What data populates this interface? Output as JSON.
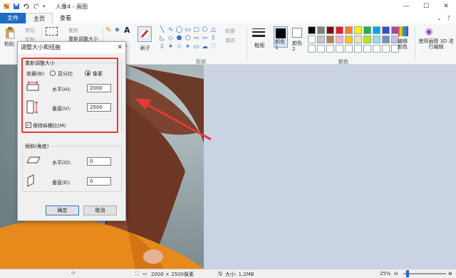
{
  "app": {
    "window_title": "人像4 - 画图",
    "window_buttons": [
      "—",
      "☐",
      "✕"
    ]
  },
  "tabs": {
    "file": "文件",
    "home": "主页",
    "view": "查看"
  },
  "ribbon": {
    "paste": "粘贴",
    "cut": "剪切",
    "copy": "复制",
    "crop": "裁剪",
    "resize": "重新调整大小",
    "rotate": "旋转",
    "brushes": "刷子",
    "outline": "轮廓",
    "fill": "填充",
    "shapes_group": "形状",
    "size": "粗细",
    "color1": "颜色 1",
    "color2": "颜色 2",
    "edit_colors": "编辑颜色",
    "paint3d": "使用画图 3D 进行编辑",
    "colors_group": "颜色",
    "palette": [
      "#000000",
      "#7f7f7f",
      "#880015",
      "#ed1c24",
      "#ff7f27",
      "#fff200",
      "#22b14c",
      "#00a2e8",
      "#3f48cc",
      "#a349a4",
      "#ffffff",
      "#c3c3c3",
      "#b97a57",
      "#ffaec9",
      "#ffc90e",
      "#efe4b0",
      "#b5e61d",
      "#99d9ea",
      "#7092be",
      "#c8bfe7",
      "#ffffff",
      "#ffffff",
      "#ffffff",
      "#ffffff",
      "#ffffff",
      "#ffffff",
      "#ffffff",
      "#ffffff",
      "#ffffff",
      "#ffffff"
    ]
  },
  "dialog": {
    "title": "调整大小和扭曲",
    "close": "✕",
    "resize_section": "重新调整大小",
    "by_label": "依据(B):",
    "percent_label": "百分比",
    "pixels_label": "像素",
    "horizontal_label": "水平(H):",
    "horizontal_value": "2000",
    "vertical_label": "垂直(V):",
    "vertical_value": "2500",
    "keep_ratio_label": "保持纵横比(M)",
    "skew_section": "倾斜(角度)",
    "skew_h_label": "水平(O):",
    "skew_h_value": "0",
    "skew_v_label": "垂直(E):",
    "skew_v_value": "0",
    "ok": "确定",
    "cancel": "取消"
  },
  "status": {
    "dimensions": "2000 × 2500像素",
    "filesize": "大小: 1.2MB",
    "zoom": "25%"
  }
}
